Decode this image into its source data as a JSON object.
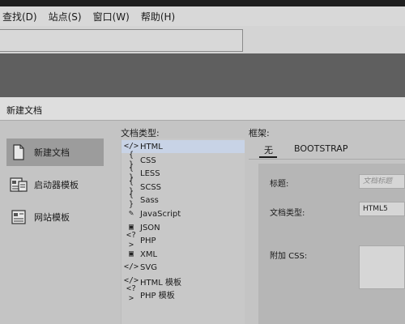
{
  "menu": {
    "items": [
      "查找(D)",
      "站点(S)",
      "窗口(W)",
      "帮助(H)"
    ]
  },
  "dialog": {
    "title": "新建文档",
    "categories": [
      {
        "label": "新建文档",
        "icon": "new-document-icon",
        "selected": true
      },
      {
        "label": "启动器模板",
        "icon": "starter-template-icon",
        "selected": false
      },
      {
        "label": "网站模板",
        "icon": "site-template-icon",
        "selected": false
      }
    ],
    "doctype": {
      "header": "文档类型:",
      "items": [
        {
          "label": "HTML",
          "glyph": "</>",
          "icon": "code-tag-icon",
          "selected": true
        },
        {
          "label": "CSS",
          "glyph": "{ }",
          "icon": "braces-icon",
          "selected": false
        },
        {
          "label": "LESS",
          "glyph": "{ }",
          "icon": "braces-icon",
          "selected": false
        },
        {
          "label": "SCSS",
          "glyph": "{ }",
          "icon": "braces-icon",
          "selected": false
        },
        {
          "label": "Sass",
          "glyph": "{ }",
          "icon": "braces-icon",
          "selected": false
        },
        {
          "label": "JavaScript",
          "glyph": "✎",
          "icon": "script-icon",
          "selected": false
        },
        {
          "label": "JSON",
          "glyph": "▣",
          "icon": "json-file-icon",
          "selected": false
        },
        {
          "label": "PHP",
          "glyph": "<?>",
          "icon": "php-icon",
          "selected": false
        },
        {
          "label": "XML",
          "glyph": "▣",
          "icon": "xml-file-icon",
          "selected": false
        },
        {
          "label": "SVG",
          "glyph": "</>",
          "icon": "code-tag-icon",
          "selected": false
        },
        {
          "label": "HTML 模板",
          "glyph": "</>",
          "icon": "code-tag-icon",
          "selected": false
        },
        {
          "label": "PHP 模板",
          "glyph": "<?>",
          "icon": "php-icon",
          "selected": false
        }
      ]
    },
    "framework": {
      "header": "框架:",
      "tabs": [
        {
          "label": "无",
          "active": true
        },
        {
          "label": "BOOTSTRAP",
          "active": false
        }
      ],
      "title_label": "标题:",
      "title_placeholder": "文档标题",
      "doctype_label": "文档类型:",
      "doctype_value": "HTML5",
      "css_label": "附加 CSS:"
    }
  }
}
